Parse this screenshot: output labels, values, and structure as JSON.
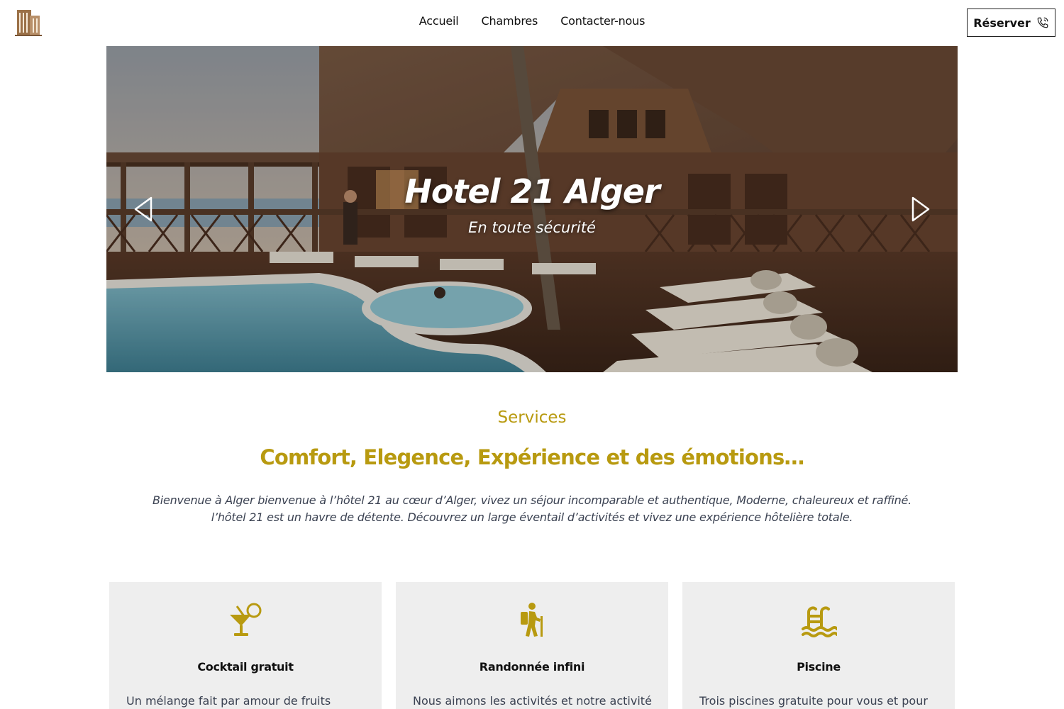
{
  "header": {
    "nav": [
      "Accueil",
      "Chambres",
      "Contacter-nous"
    ],
    "reserve_label": "Réserver",
    "logo_icon": "hotel-building-icon",
    "reserve_icon": "phone-call-icon"
  },
  "hero": {
    "title": "Hotel 21 Alger",
    "subtitle": "En toute sécurité",
    "prev_icon": "chevron-left-icon",
    "next_icon": "chevron-right-icon"
  },
  "services": {
    "label": "Services",
    "heading": "Comfort, Elegence, Expérience et des émotions…",
    "description": "Bienvenue à Alger bienvenue à l’hôtel 21 au cœur d’Alger, vivez un séjour incomparable et authentique, Moderne, chaleureux et raffiné. l’hôtel 21 est un havre de détente. Découvrez un large éventail d’activités et vivez une expérience hôtelière totale.",
    "cards": [
      {
        "icon": "cocktail-icon",
        "title": "Cocktail gratuit",
        "text": "Un mélange fait par amour de fruits"
      },
      {
        "icon": "hiking-icon",
        "title": "Randonnée infini",
        "text": "Nous aimons les activités et notre activité"
      },
      {
        "icon": "swimming-pool-icon",
        "title": "Piscine",
        "text": "Trois piscines gratuite pour vous et pour"
      }
    ]
  },
  "colors": {
    "accent": "#b89a10",
    "card_bg": "#eeeeee",
    "logo_brown": "#9b7148"
  }
}
